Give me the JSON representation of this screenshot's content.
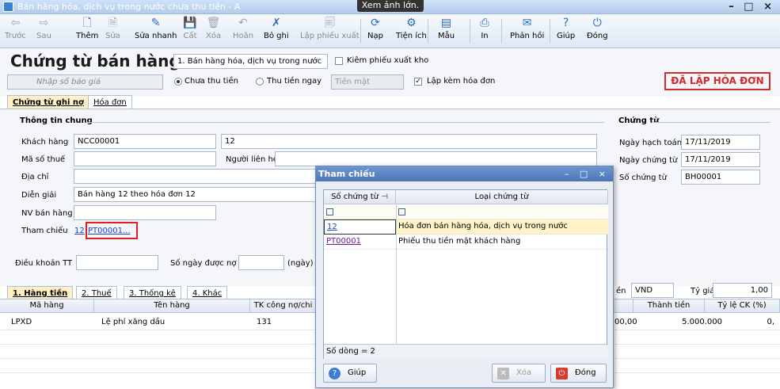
{
  "window": {
    "title": "Bán hàng hóa, dịch vụ trong nước chưa thu tiền - A",
    "tooltip": "Xem ảnh lớn.",
    "controls": "– □ ×"
  },
  "toolbar": {
    "items": [
      {
        "label": "Trước",
        "icon": "arrow-left-icon",
        "glyph": "⇦",
        "enabled": false
      },
      {
        "label": "Sau",
        "icon": "arrow-right-icon",
        "glyph": "⇨",
        "enabled": false
      },
      {
        "label": "Thêm",
        "icon": "add-document-icon",
        "glyph": "🗋",
        "enabled": true
      },
      {
        "label": "Sửa",
        "icon": "edit-document-icon",
        "glyph": "🗎",
        "enabled": false
      },
      {
        "label": "Sửa nhanh",
        "icon": "quick-edit-icon",
        "glyph": "✎",
        "enabled": true
      },
      {
        "label": "Cất",
        "icon": "save-icon",
        "glyph": "💾",
        "enabled": false
      },
      {
        "label": "Xóa",
        "icon": "delete-icon",
        "glyph": "🗑",
        "enabled": false
      },
      {
        "label": "Hoãn",
        "icon": "undo-icon",
        "glyph": "↶",
        "enabled": false
      },
      {
        "label": "Bỏ ghi",
        "icon": "unpost-icon",
        "glyph": "✗",
        "enabled": true
      },
      {
        "label": "Lập phiếu xuất",
        "icon": "export-slip-icon",
        "glyph": "🗐",
        "enabled": false
      },
      {
        "label": "Nạp",
        "icon": "reload-icon",
        "glyph": "⟳",
        "enabled": true
      },
      {
        "label": "Tiện ích",
        "icon": "utilities-icon",
        "glyph": "⚙",
        "enabled": true
      },
      {
        "label": "Mẫu",
        "icon": "template-icon",
        "glyph": "▤",
        "enabled": true
      },
      {
        "label": "In",
        "icon": "print-icon",
        "glyph": "⎙",
        "enabled": true
      },
      {
        "label": "Phản hồi",
        "icon": "feedback-icon",
        "glyph": "✉",
        "enabled": true
      },
      {
        "label": "Giúp",
        "icon": "help-icon",
        "glyph": "?",
        "enabled": true
      },
      {
        "label": "Đóng",
        "icon": "close-icon",
        "glyph": "⏻",
        "enabled": true
      }
    ]
  },
  "header": {
    "title": "Chứng từ bán hàng",
    "voucher_type": "1. Bán hàng hóa, dịch vụ trong nước",
    "issue_stock_slip_label": "Kiêm phiếu xuất kho",
    "quote_placeholder": "Nhập số báo giá",
    "payment_options": [
      "Chưa thu tiền",
      "Thu tiền ngay"
    ],
    "payment_method": "Tiền mặt",
    "with_invoice_label": "Lập kèm hóa đơn",
    "stamp": "ĐÃ LẬP HÓA ĐƠN"
  },
  "tabs": {
    "tab1": "Chứng từ ghi nợ",
    "tab2": "Hóa đơn"
  },
  "general": {
    "section_title": "Thông tin chung",
    "customer_label": "Khách hàng",
    "customer_code": "NCC00001",
    "customer_name": "12",
    "tax_label": "Mã số thuế",
    "contact_label": "Người liên hệ",
    "address_label": "Địa chỉ",
    "desc_label": "Diễn giải",
    "desc_value": "Bán hàng 12 theo hóa đơn 12",
    "staff_label": "NV bán hàng",
    "ref_label": "Tham chiếu",
    "ref1": "12",
    "ref2": "PT00001",
    "ref_more": "..."
  },
  "voucher": {
    "section_title": "Chứng từ",
    "post_date_label": "Ngày hạch toán",
    "post_date": "17/11/2019",
    "voucher_date_label": "Ngày chứng từ",
    "voucher_date": "17/11/2019",
    "voucher_no_label": "Số chứng từ",
    "voucher_no": "BH00001"
  },
  "terms": {
    "label": "Điều khoản TT",
    "days_label": "Số ngày được nợ",
    "days_unit": "(ngày)"
  },
  "currency": {
    "partial_label": "ền",
    "code": "VND",
    "rate_label": "Tỷ giá",
    "rate": "1,00"
  },
  "bottom_tabs": [
    "1. Hàng tiền",
    "2. Thuế",
    "3. Thống kê",
    "4. Khác"
  ],
  "grid": {
    "headers": {
      "code": "Mã hàng",
      "name": "Tên hàng",
      "account": "TK công nợ/chi",
      "amount": "Thành tiền",
      "discount": "Tỷ lệ CK (%)"
    },
    "rows": [
      {
        "code": "LPXD",
        "name": "Lệ phí xăng dầu",
        "account": "131",
        "unit_price_tail": "00,00",
        "amount": "5.000.000",
        "discount": "0,"
      }
    ]
  },
  "dialog": {
    "title": "Tham chiếu",
    "col_no": "Số chứng từ",
    "col_type": "Loại chứng từ",
    "rows": [
      {
        "no": "12",
        "type": "Hóa đơn bán hàng hóa, dịch vụ trong nước"
      },
      {
        "no": "PT00001",
        "type": "Phiếu thu tiền mặt khách hàng"
      }
    ],
    "footer_count": "Số dòng = 2",
    "help_button": "Giúp",
    "delete_button": "Xóa",
    "close_button": "Đóng"
  }
}
